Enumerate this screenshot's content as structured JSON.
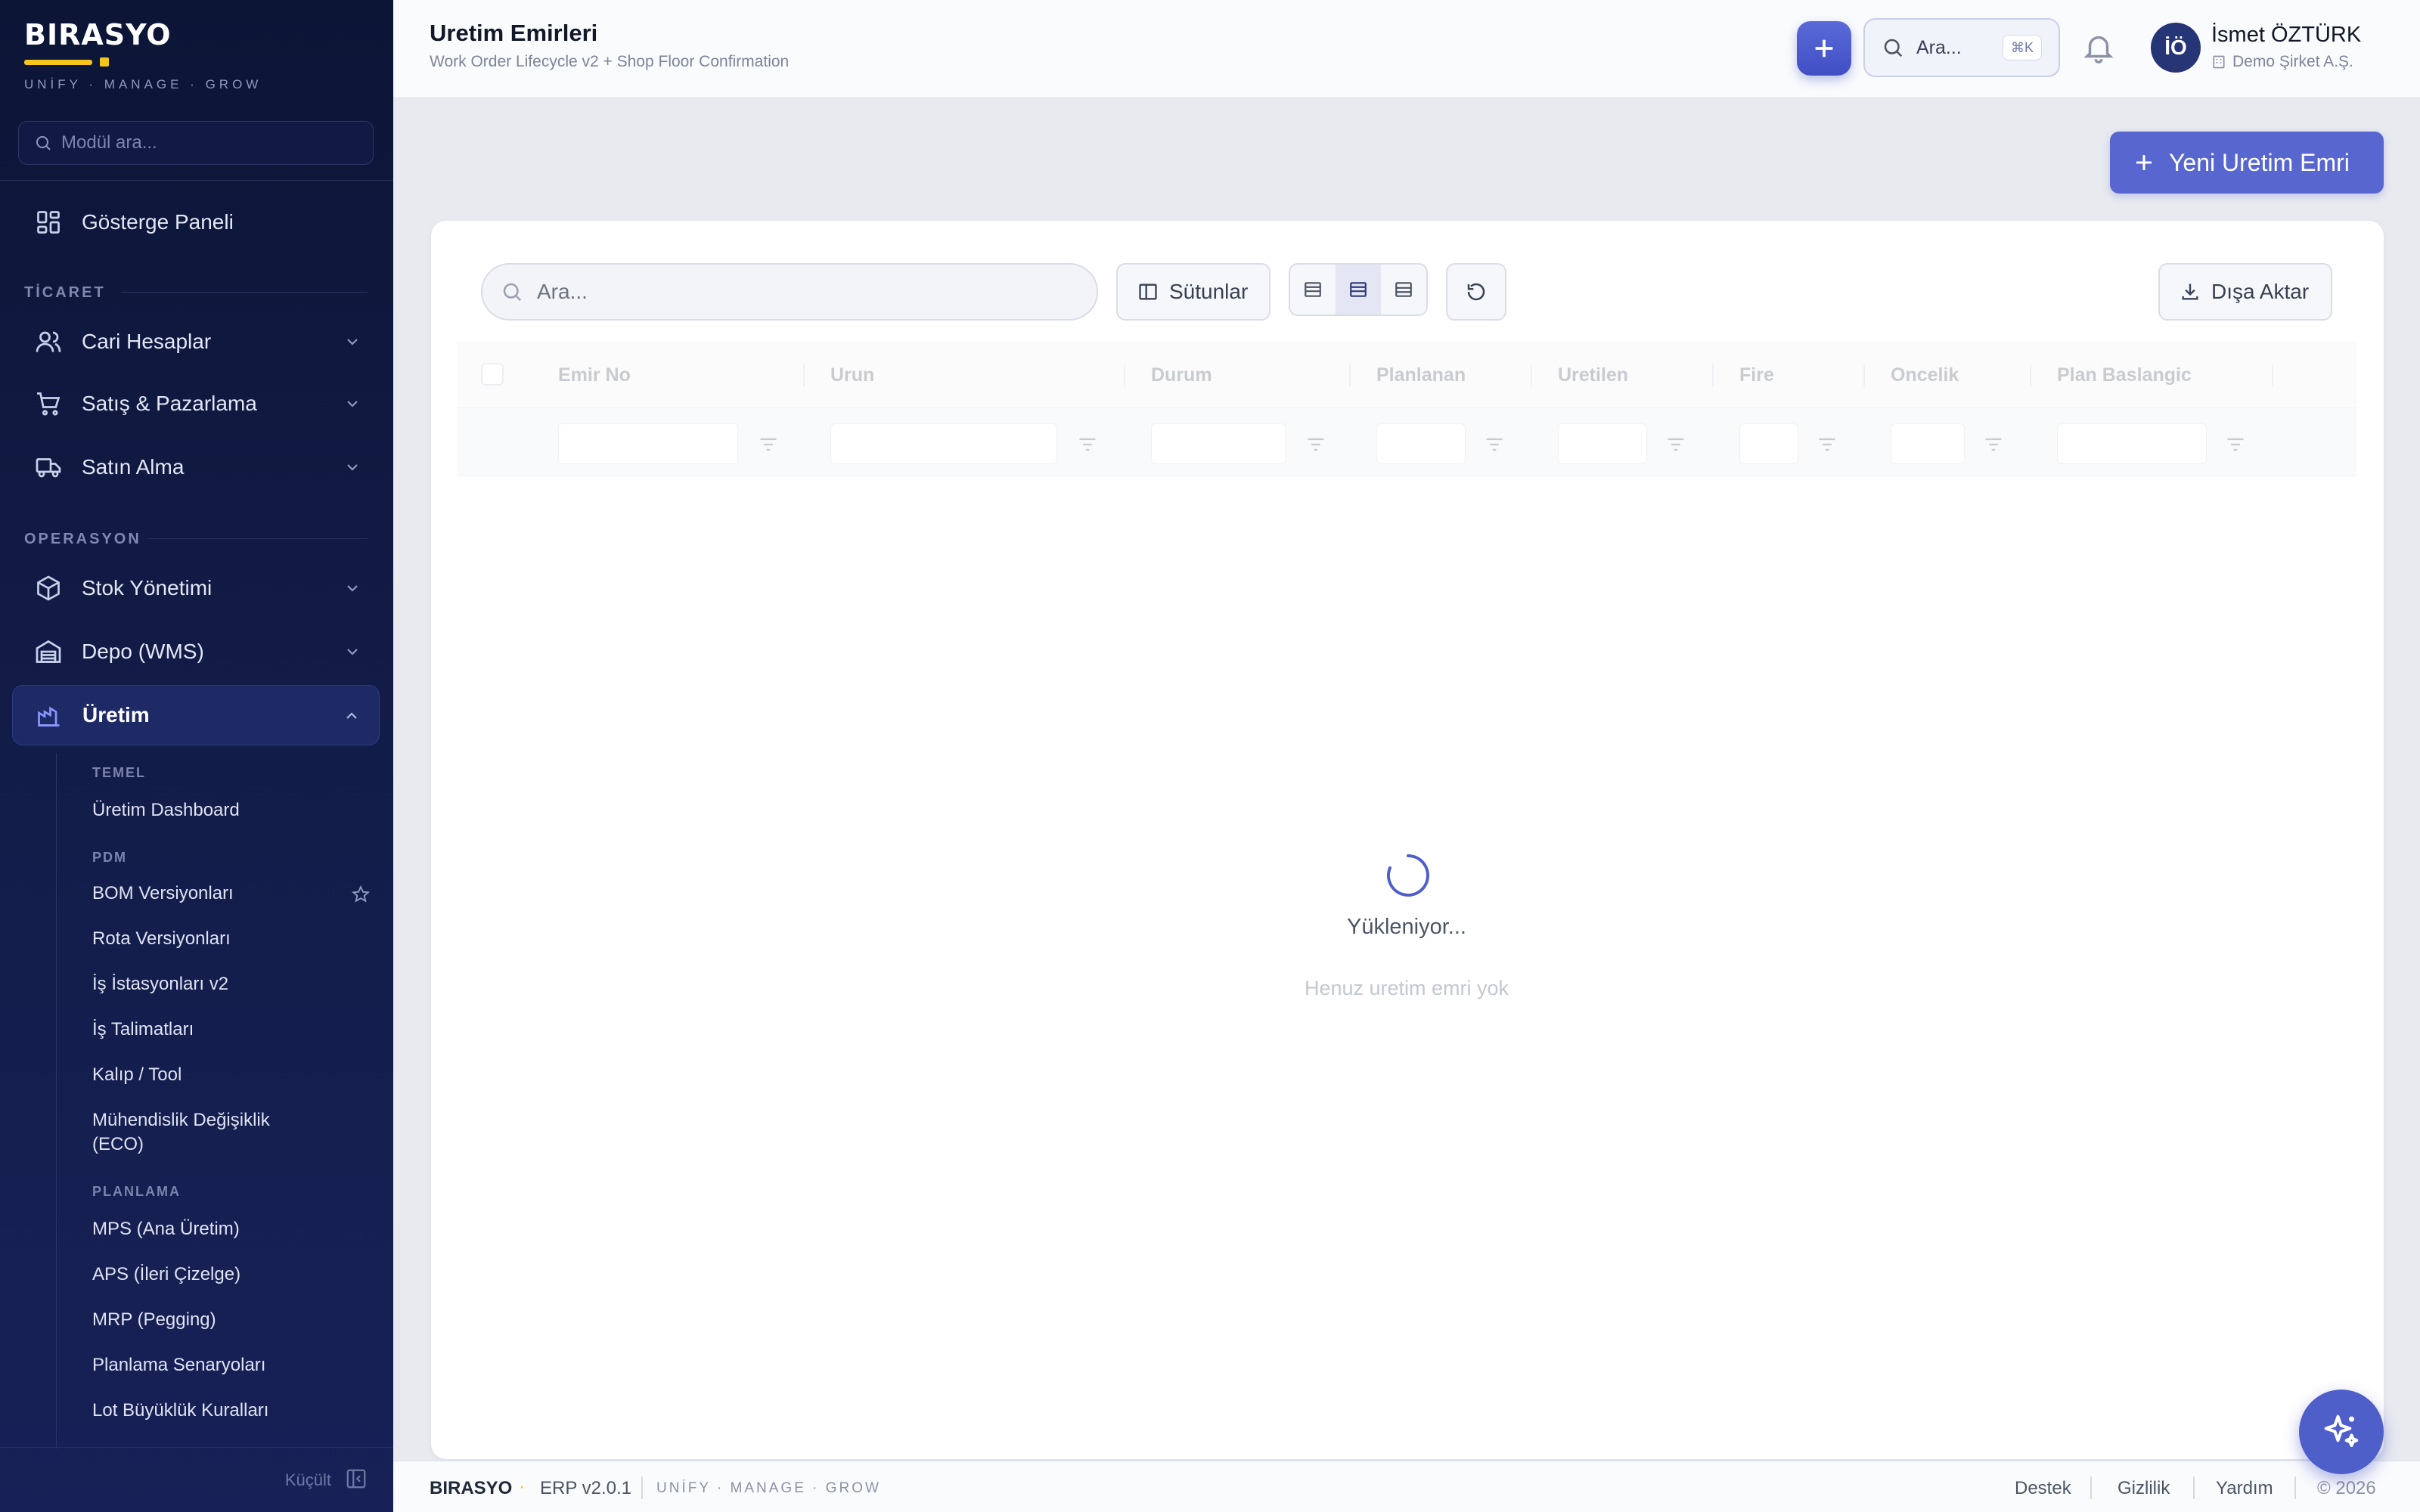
{
  "brand": {
    "name": "BIRASYO",
    "tagline": "UNİFY · MANAGE · GROW"
  },
  "sidebar": {
    "search_placeholder": "Modül ara...",
    "dashboard": "Gösterge Paneli",
    "section_commerce": "TİCARET",
    "commerce_items": [
      {
        "label": "Cari Hesaplar",
        "icon": "users-icon"
      },
      {
        "label": "Satış & Pazarlama",
        "icon": "cart-icon"
      },
      {
        "label": "Satın Alma",
        "icon": "truck-icon"
      }
    ],
    "section_ops": "OPERASYON",
    "ops_items": [
      {
        "label": "Stok Yönetimi",
        "icon": "box-icon"
      },
      {
        "label": "Depo (WMS)",
        "icon": "warehouse-icon"
      }
    ],
    "active_item": "Üretim",
    "sub_sections": {
      "temel": "TEMEL",
      "pdm": "PDM",
      "planlama": "PLANLAMA"
    },
    "sub_items": {
      "temel": [
        "Üretim Dashboard"
      ],
      "pdm": [
        "BOM Versiyonları",
        "Rota Versiyonları",
        "İş İstasyonları v2",
        "İş Talimatları",
        "Kalıp / Tool",
        "Mühendislik Değişiklik",
        "(ECO)"
      ],
      "planlama": [
        "MPS (Ana Üretim)",
        "APS (İleri Çizelge)",
        "MRP (Pegging)",
        "Planlama Senaryoları",
        "Lot Büyüklük Kuralları"
      ]
    },
    "collapse_label": "Küçült"
  },
  "header": {
    "title": "Uretim Emirleri",
    "subtitle": "Work Order Lifecycle v2 + Shop Floor Confirmation",
    "search_label": "Ara...",
    "shortcut": "⌘K",
    "user_initials": "İÖ",
    "user_name": "İsmet ÖZTÜRK",
    "company": "Demo Şirket A.Ş."
  },
  "actions": {
    "new_order": "Yeni Uretim Emri"
  },
  "toolbar": {
    "search_placeholder": "Ara...",
    "columns_label": "Sütunlar",
    "export_label": "Dışa Aktar"
  },
  "grid": {
    "columns": [
      "Emir No",
      "Urun",
      "Durum",
      "Planlanan",
      "Uretilen",
      "Fire",
      "Oncelik",
      "Plan Baslangic"
    ],
    "loading_text": "Yükleniyor...",
    "empty_text": "Henuz uretim emri yok"
  },
  "footer": {
    "brand": "BIRASYO",
    "version": "ERP v2.0.1",
    "tagline": "UNİFY · MANAGE · GROW",
    "links": [
      "Destek",
      "Gizlilik",
      "Yardım"
    ],
    "copyright": "© 2026"
  },
  "colors": {
    "accent": "#5867cf",
    "sidebar_bg": "#0c1536",
    "brand_yellow": "#f5c518"
  }
}
